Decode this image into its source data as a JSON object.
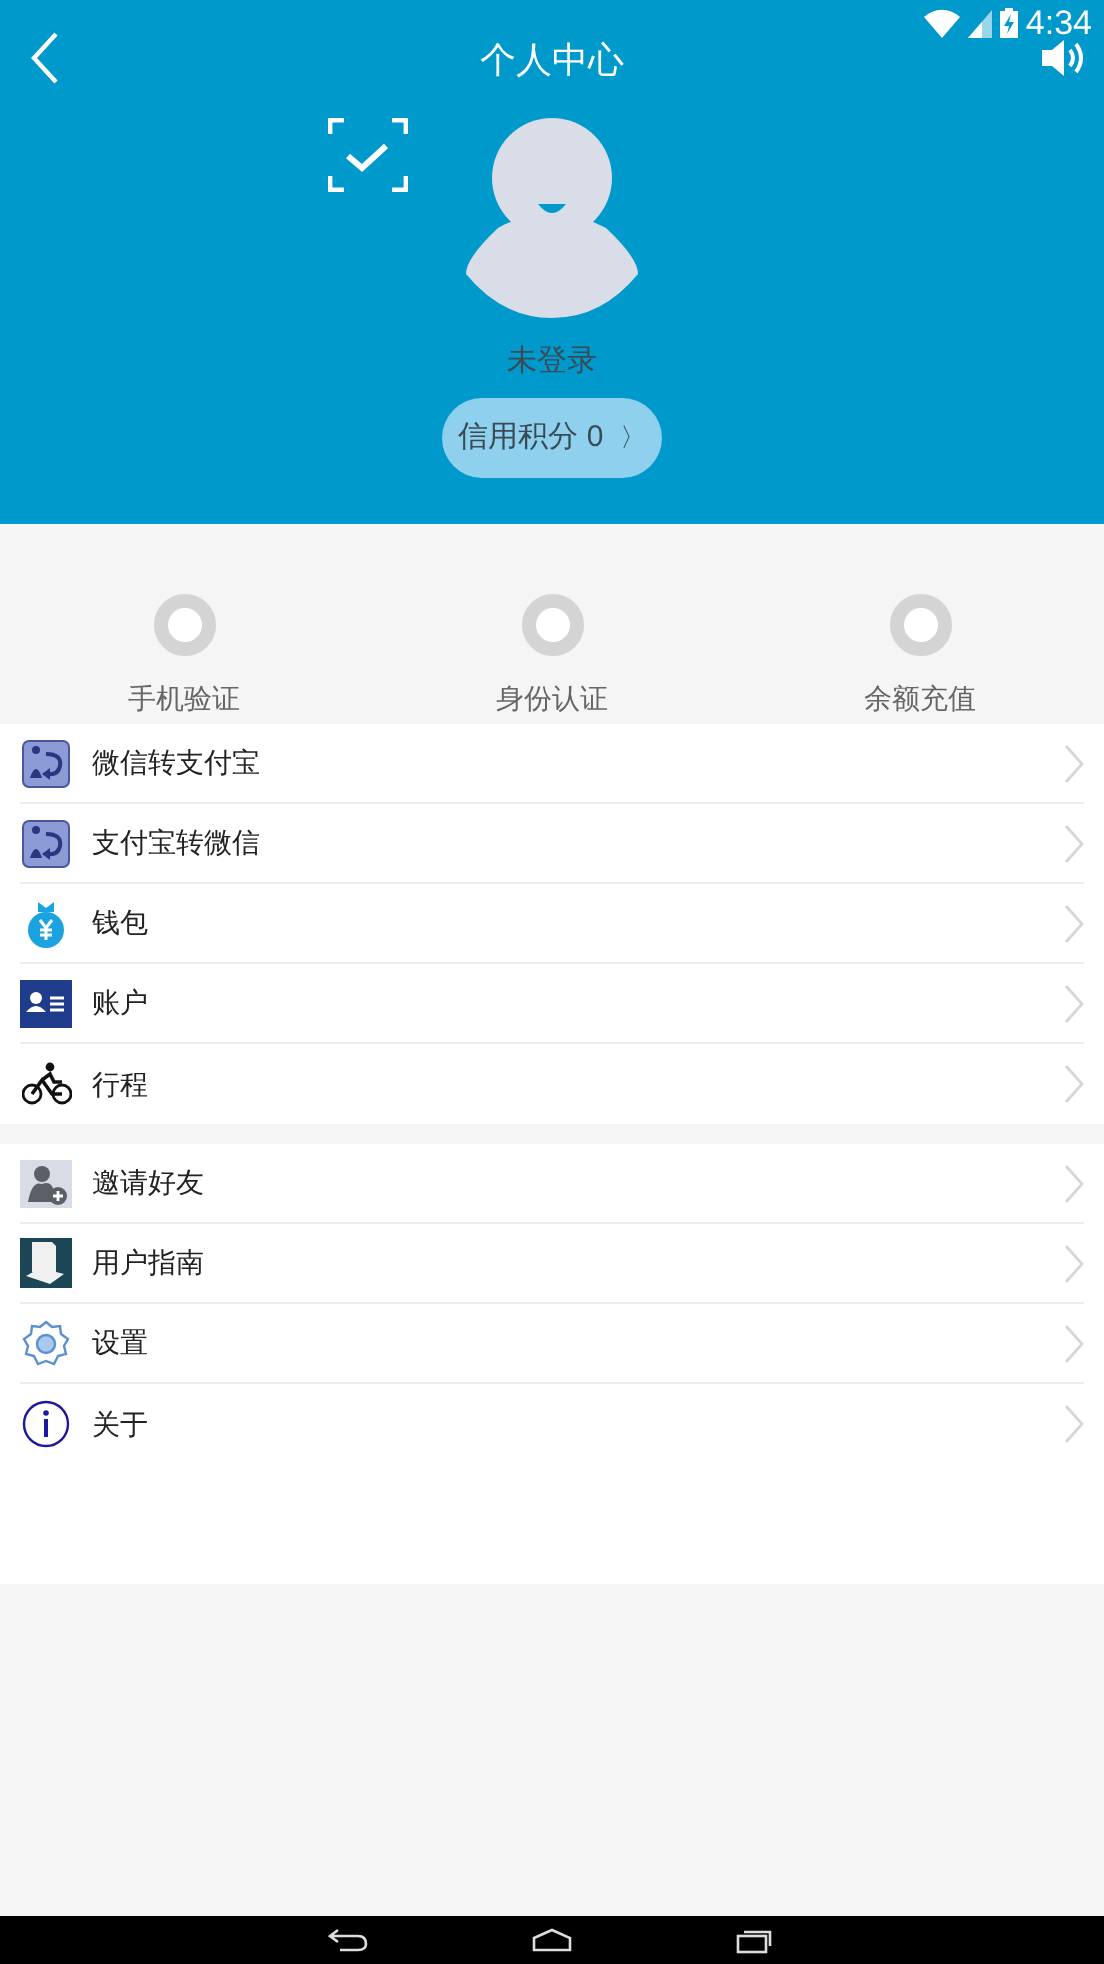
{
  "status_bar": {
    "time": "4:34"
  },
  "header": {
    "title": "个人中心",
    "login_status": "未登录",
    "credit_button": "信用积分 0",
    "credit_chevron": "〉"
  },
  "verifications": [
    {
      "label": "手机验证"
    },
    {
      "label": "身份认证"
    },
    {
      "label": "余额充值"
    }
  ],
  "menu_groups": [
    [
      {
        "kind": "transfer",
        "label": "微信转支付宝"
      },
      {
        "kind": "transfer",
        "label": "支付宝转微信"
      },
      {
        "kind": "wallet",
        "label": "钱包"
      },
      {
        "kind": "account",
        "label": "账户"
      },
      {
        "kind": "bicycle",
        "label": "行程"
      }
    ],
    [
      {
        "kind": "invite",
        "label": "邀请好友"
      },
      {
        "kind": "guide",
        "label": "用户指南"
      },
      {
        "kind": "settings",
        "label": "设置"
      },
      {
        "kind": "about",
        "label": "关于"
      }
    ]
  ]
}
